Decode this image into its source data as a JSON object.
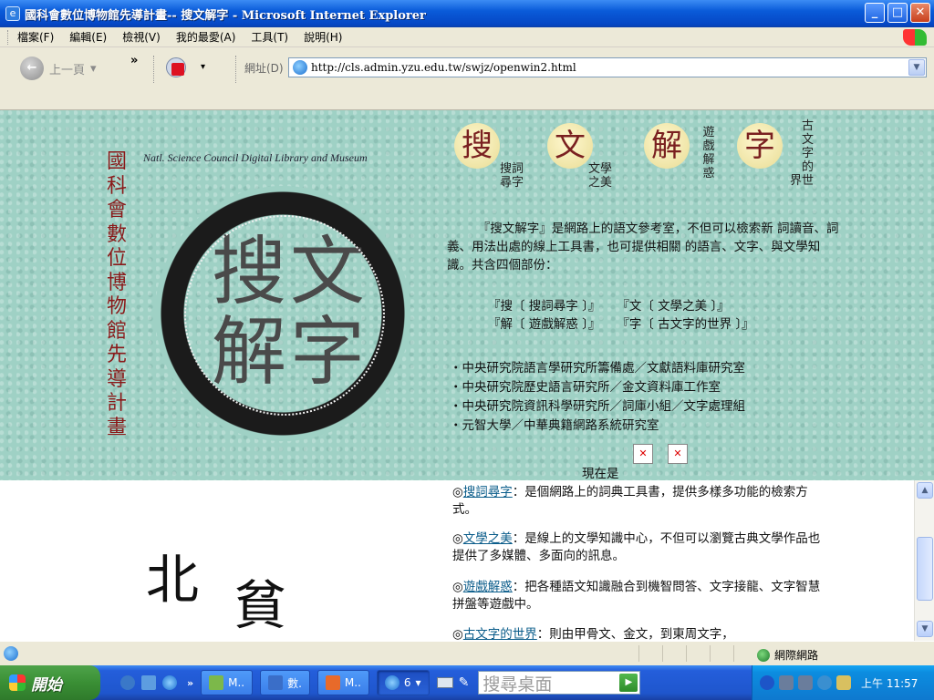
{
  "window": {
    "title": "國科會數位博物館先導計畫-- 搜文解字 - Microsoft Internet Explorer",
    "buttons": {
      "minimize": "_",
      "maximize": "□",
      "close": "✕"
    }
  },
  "menu": {
    "items": [
      "檔案(F)",
      "編輯(E)",
      "檢視(V)",
      "我的最愛(A)",
      "工具(T)",
      "說明(H)"
    ]
  },
  "toolbar": {
    "back_label": "上一頁",
    "back_dropdown": "▾",
    "more": "»",
    "pdf_dropdown": "▾",
    "address_label": "網址(D)",
    "address_value": "http://cls.admin.yzu.edu.tw/swjz/openwin2.html"
  },
  "page": {
    "vertical_title": [
      "國",
      "科",
      "會",
      "數",
      "位",
      "博",
      "物",
      "館",
      "先",
      "導",
      "計",
      "畫"
    ],
    "subtitle": "Natl. Science Council Digital Library and Museum",
    "seal_chars": [
      "搜",
      "文",
      "解",
      "字"
    ],
    "nav": [
      {
        "glyph": "搜",
        "label_lines": [
          "搜詞",
          "尋字"
        ]
      },
      {
        "glyph": "文",
        "label_lines": [
          "文學",
          "之美"
        ]
      },
      {
        "glyph": "解",
        "label_lines": [
          "遊",
          "戲",
          "解",
          "惑"
        ]
      },
      {
        "glyph": "字",
        "label_lines": [
          "古",
          "文",
          "字",
          "的",
          "界世"
        ]
      }
    ],
    "intro": "『搜文解字』是網路上的語文參考室，不但可以檢索新 詞讀音、詞義、用法出處的線上工具書，也可提供相關 的語言、文字、與文學知識。共含四個部份：",
    "parts": [
      [
        "『搜〔 搜詞尋字 〕』",
        "『文〔 文學之美 〕』"
      ],
      [
        "『解〔 遊戲解惑 〕』",
        "『字〔 古文字的世界 〕』"
      ]
    ],
    "orgs": [
      "・中央研究院語言學研究所籌備處／文獻語料庫研究室",
      "・中央研究院歷史語言研究所／金文資料庫工作室",
      "・中央研究院資訊科學研究所／詞庫小組／文字處理組",
      "・元智大學／中華典籍網路系統研究室"
    ],
    "now_label": "現在是",
    "broken_image": "✕",
    "descriptions": [
      {
        "prefix": "◎",
        "link": "搜詞尋字",
        "text": "：是個網路上的詞典工具書，提供多樣多功能的檢索方式。"
      },
      {
        "prefix": "◎",
        "link": "文學之美",
        "text": "：是線上的文學知識中心，不但可以瀏覽古典文學作品也提供了多媒體、多面向的訊息。"
      },
      {
        "prefix": "◎",
        "link": "遊戲解惑",
        "text": "：把各種語文知識融合到機智問答、文字接龍、文字智慧拼盤等遊戲中。"
      },
      {
        "prefix": "◎",
        "link": "古文字的世界",
        "text": "：則由甲骨文、金文，到東周文字，"
      }
    ],
    "calligraphy": [
      "北",
      "貧"
    ]
  },
  "status": {
    "zone": "網際網路"
  },
  "taskbar": {
    "start_label": "開始",
    "tasks": [
      "M..",
      "數.",
      "M..",
      "6"
    ],
    "search_placeholder": "搜尋桌面",
    "clock": "上午 11:57"
  },
  "colors": {
    "banner_bg": "#9fd1c5",
    "title_red": "#8a1a1a",
    "link": "#0a5c8a"
  }
}
